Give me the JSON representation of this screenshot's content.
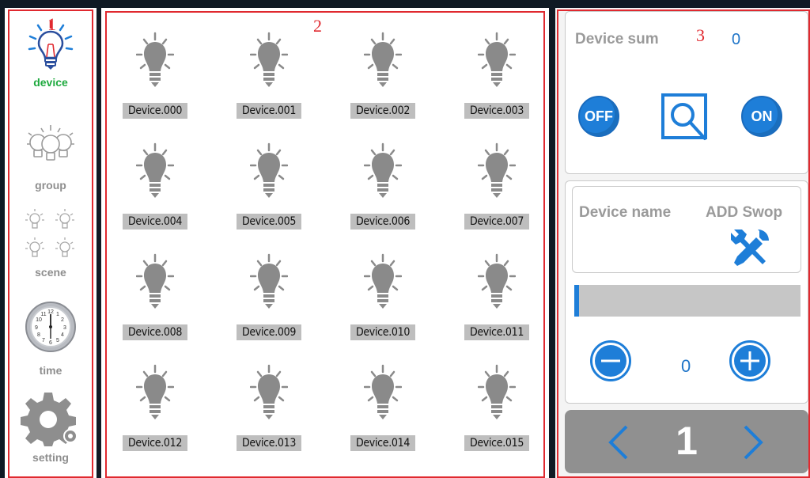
{
  "sidebar": {
    "items": [
      {
        "label": "device",
        "icon": "bulb-color-icon",
        "active": true
      },
      {
        "label": "group",
        "icon": "bulb-group-icon",
        "active": false
      },
      {
        "label": "scene",
        "icon": "scene-bulbs-icon",
        "active": false
      },
      {
        "label": "time",
        "icon": "clock-icon",
        "active": false
      },
      {
        "label": "setting",
        "icon": "gear-icon",
        "active": false
      }
    ]
  },
  "regions": [
    "1",
    "2",
    "3"
  ],
  "devices": [
    "Device.000",
    "Device.001",
    "Device.002",
    "Device.003",
    "Device.004",
    "Device.005",
    "Device.006",
    "Device.007",
    "Device.008",
    "Device.009",
    "Device.010",
    "Device.011",
    "Device.012",
    "Device.013",
    "Device.014",
    "Device.015"
  ],
  "control": {
    "device_sum_label": "Device sum",
    "device_sum_value": "0",
    "off_label": "OFF",
    "on_label": "ON",
    "device_name_label": "Device name",
    "add_swop_label": "ADD Swop",
    "level_value": "0",
    "progress_fraction": 0.02,
    "page_number": "1"
  },
  "colors": {
    "accent": "#1e7ed8",
    "active_green": "#1faa3f",
    "region_red": "#e0292f",
    "inactive_gray": "#8e8e8e"
  }
}
